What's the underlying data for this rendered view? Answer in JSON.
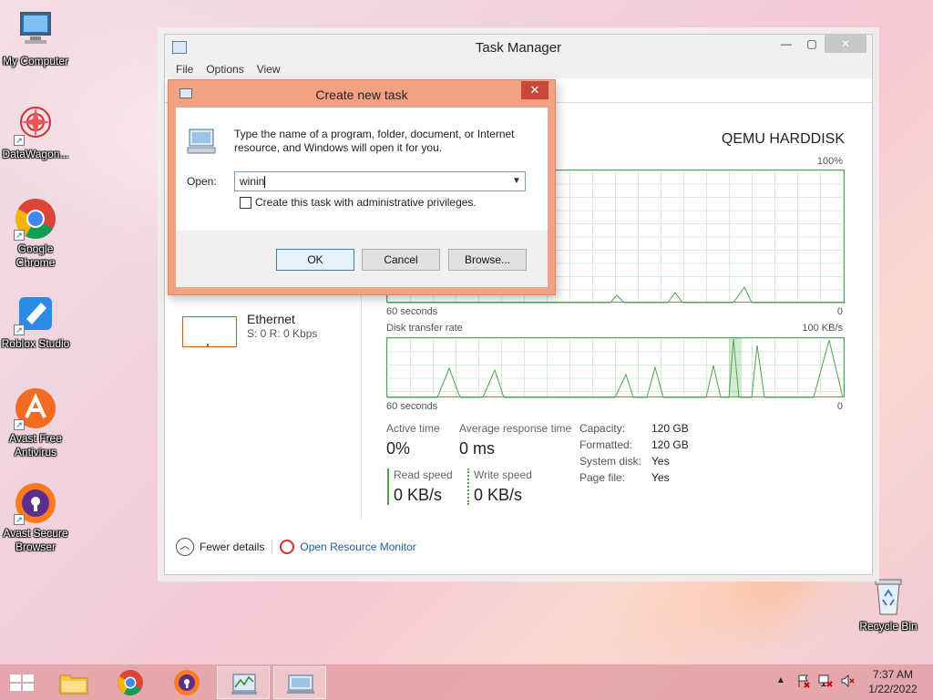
{
  "desktop": {
    "icons": [
      {
        "label": "My Computer"
      },
      {
        "label": "DataWagon..."
      },
      {
        "label": "Google Chrome"
      },
      {
        "label": "Roblox Studio"
      },
      {
        "label": "Avast Free Antivirus"
      },
      {
        "label": "Avast Secure Browser"
      },
      {
        "label": "Recycle Bin"
      }
    ]
  },
  "task_manager": {
    "title": "Task Manager",
    "menu": [
      "File",
      "Options",
      "View"
    ],
    "left": {
      "ethernet_label": "Ethernet",
      "ethernet_value": "S: 0 R: 0 Kbps"
    },
    "disk_name": "QEMU HARDDISK",
    "graph1": {
      "max_label": "100%",
      "time_label": "60 seconds",
      "min_label": "0"
    },
    "graph2": {
      "title": "Disk transfer rate",
      "max_label": "100 KB/s",
      "time_label": "60 seconds",
      "min_label": "0"
    },
    "stats": {
      "active_time_label": "Active time",
      "active_time_value": "0%",
      "avg_resp_label": "Average response time",
      "avg_resp_value": "0 ms",
      "read_label": "Read speed",
      "read_value": "0 KB/s",
      "write_label": "Write speed",
      "write_value": "0 KB/s"
    },
    "props": [
      {
        "k": "Capacity:",
        "v": "120 GB"
      },
      {
        "k": "Formatted:",
        "v": "120 GB"
      },
      {
        "k": "System disk:",
        "v": "Yes"
      },
      {
        "k": "Page file:",
        "v": "Yes"
      }
    ],
    "footer": {
      "fewer_details": "Fewer details",
      "resource_monitor": "Open Resource Monitor"
    }
  },
  "dialog": {
    "title": "Create new task",
    "close": "✕",
    "description": "Type the name of a program, folder, document, or Internet resource, and Windows will open it for you.",
    "open_label": "Open:",
    "open_value": "winin",
    "admin_checkbox_label": "Create this task with administrative privileges.",
    "ok": "OK",
    "cancel": "Cancel",
    "browse": "Browse..."
  },
  "taskbar": {
    "time": "7:37 AM",
    "date": "1/22/2022"
  },
  "colors": {
    "dialog_frame": "#f2a182",
    "graph_line": "#4ca64c",
    "link": "#1a5fb4",
    "taskbar": "#e2a0a5"
  }
}
